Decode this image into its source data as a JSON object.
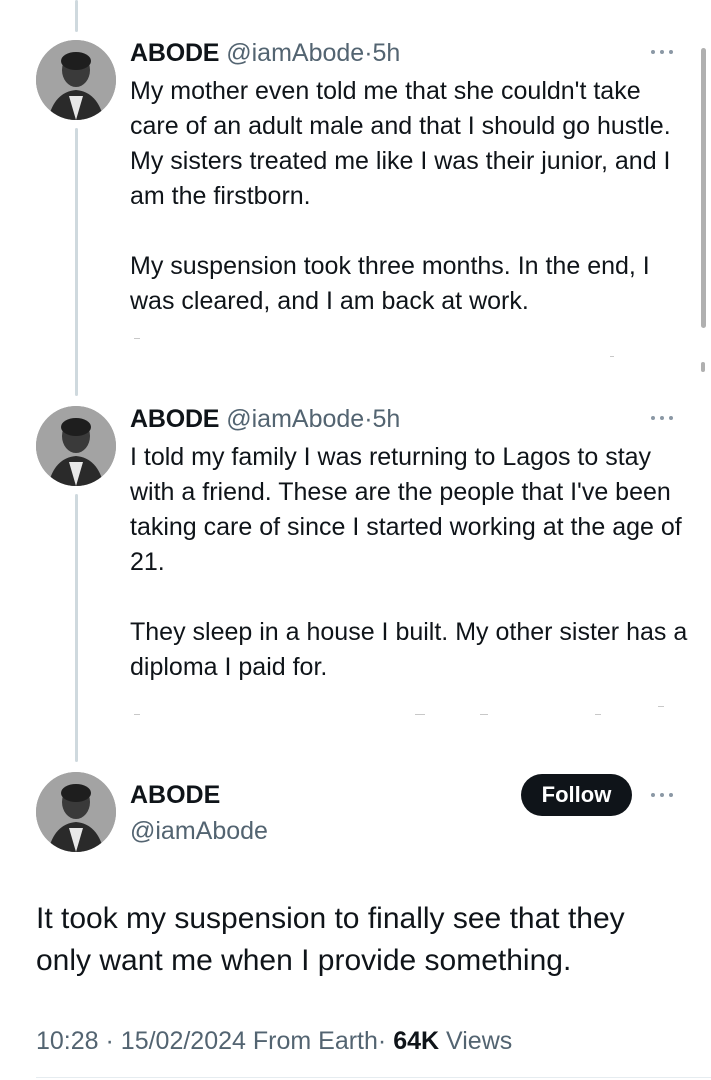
{
  "tweets": [
    {
      "name": "ABODE",
      "handle": "@iamAbode",
      "separator": "·",
      "time": "5h",
      "paragraphs": [
        "My mother even told me that she couldn't take care of an adult male and that I should go hustle. My sisters treated me like I was their junior, and I am the firstborn.",
        "My suspension took three months. In the end, I was cleared, and I am back at work."
      ]
    },
    {
      "name": "ABODE",
      "handle": "@iamAbode",
      "separator": "·",
      "time": "5h",
      "paragraphs": [
        "I told my family I was returning to Lagos to stay with a friend. These are the people that I've been taking care of since I started working at the age of 21.",
        "They sleep in a house I built. My other sister has a diploma I paid for."
      ]
    }
  ],
  "main_tweet": {
    "name": "ABODE",
    "handle": "@iamAbode",
    "follow_label": "Follow",
    "text": "It took my suspension to finally see that they only want me when I provide something.",
    "time": "10:28",
    "date": "15/02/2024",
    "location": "From Earth",
    "separator": "·",
    "views_count": "64K",
    "views_label": "Views"
  },
  "icons": {
    "more": "more-horizontal-icon",
    "avatar": "profile-photo"
  },
  "colors": {
    "text": "#0f1419",
    "secondary": "#536471",
    "thread_line": "#cfd9de",
    "follow_bg": "#0f1419"
  }
}
